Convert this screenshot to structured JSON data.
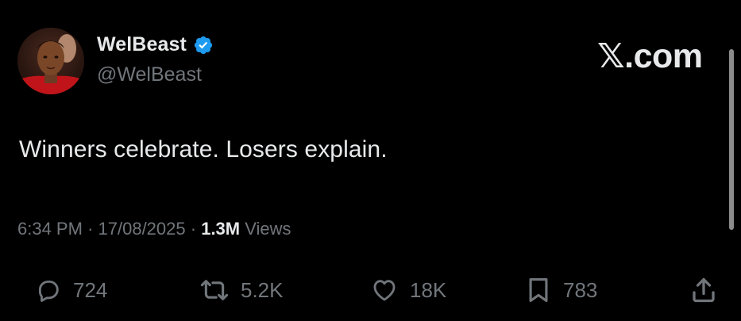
{
  "author": {
    "display_name": "WelBeast",
    "handle": "@WelBeast",
    "verified": true
  },
  "brand": "𝕏.com",
  "tweet": {
    "text": "Winners celebrate. Losers explain."
  },
  "meta": {
    "time": "6:34 PM",
    "separator": "·",
    "date": "17/08/2025",
    "views_count": "1.3M",
    "views_label": "Views"
  },
  "actions": {
    "reply_count": "724",
    "repost_count": "5.2K",
    "like_count": "18K",
    "bookmark_count": "783"
  },
  "icons": {
    "reply": "speech-bubble-icon",
    "repost": "repost-arrows-icon",
    "like": "heart-icon",
    "bookmark": "bookmark-icon",
    "share": "share-upload-icon",
    "verified": "verified-badge-icon"
  },
  "colors": {
    "background": "#000000",
    "primary_text": "#e7e9ea",
    "secondary_text": "#71767b",
    "verified_blue": "#1d9bf0"
  }
}
